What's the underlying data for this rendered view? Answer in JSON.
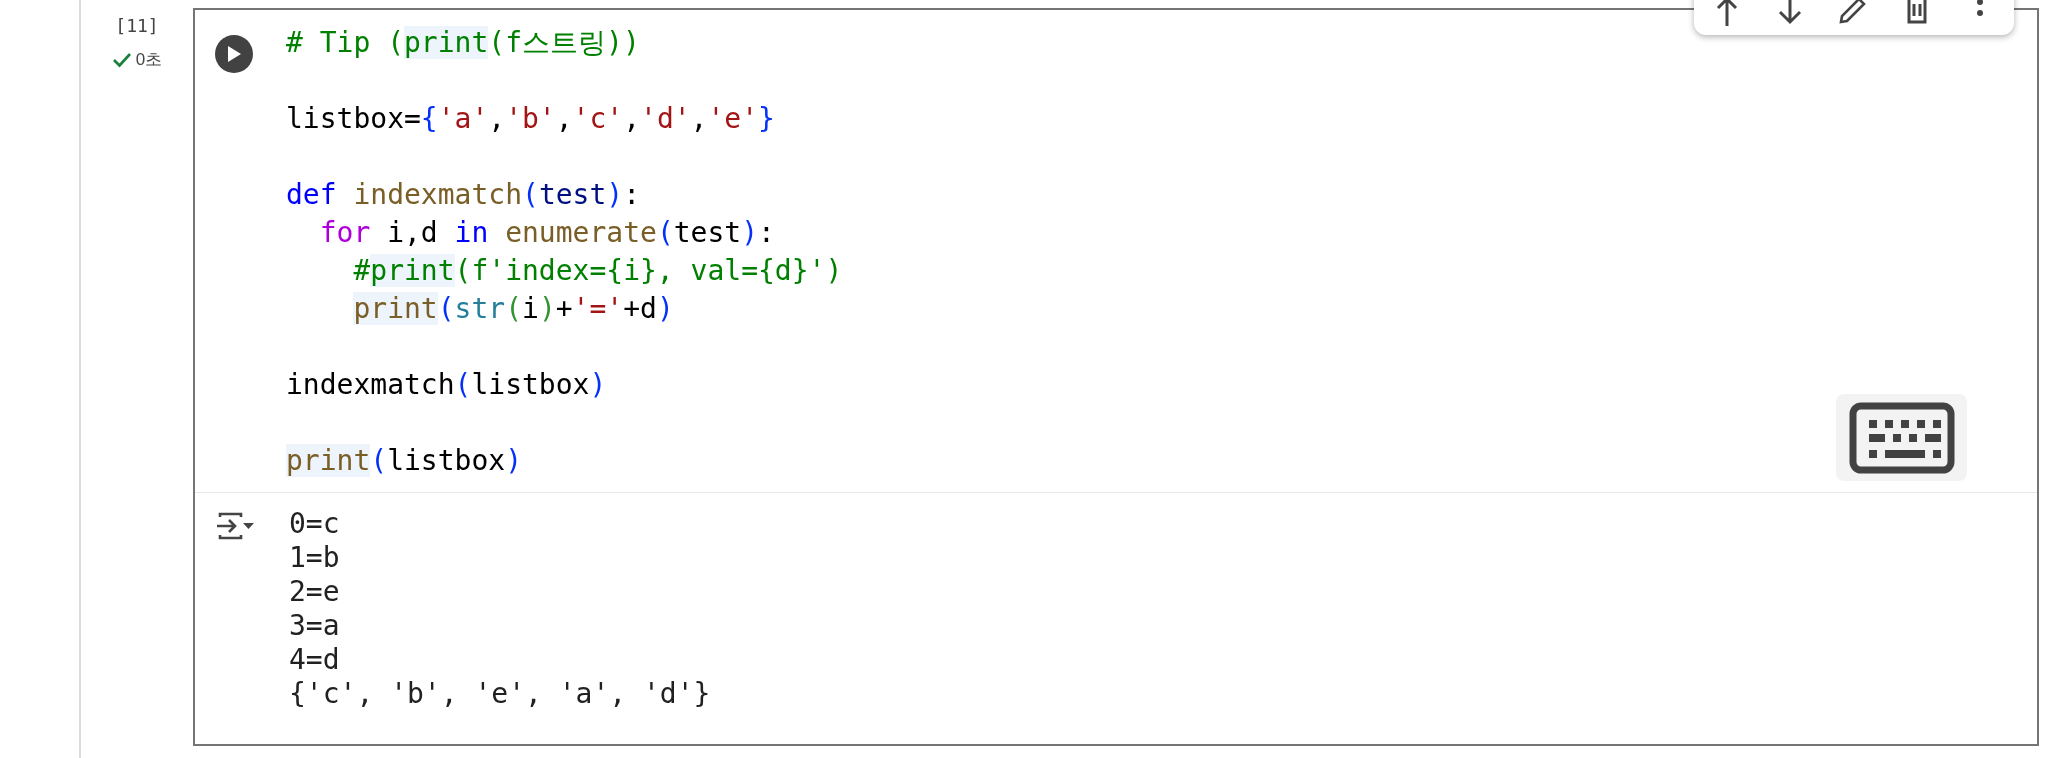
{
  "cell": {
    "execution_count": "[11]",
    "status": {
      "succeeded": true,
      "duration": "0초"
    },
    "code": {
      "blocks": [
        {
          "lines": [
            {
              "tokens": [
                {
                  "text": "# Tip (",
                  "kind": "comment",
                  "highlighted": false
                },
                {
                  "text": "print",
                  "kind": "comment",
                  "highlighted": true
                },
                {
                  "text": "(f스트링))",
                  "kind": "comment",
                  "highlighted": false
                }
              ]
            }
          ]
        },
        {
          "lines": [
            {
              "tokens": [
                {
                  "text": "listbox=",
                  "kind": "plain",
                  "highlighted": false
                },
                {
                  "text": "{",
                  "kind": "bracket",
                  "highlighted": false
                },
                {
                  "text": "'a'",
                  "kind": "string",
                  "highlighted": false
                },
                {
                  "text": ",",
                  "kind": "plain",
                  "highlighted": false
                },
                {
                  "text": "'b'",
                  "kind": "string",
                  "highlighted": false
                },
                {
                  "text": ",",
                  "kind": "plain",
                  "highlighted": false
                },
                {
                  "text": "'c'",
                  "kind": "string",
                  "highlighted": false
                },
                {
                  "text": ",",
                  "kind": "plain",
                  "highlighted": false
                },
                {
                  "text": "'d'",
                  "kind": "string",
                  "highlighted": false
                },
                {
                  "text": ",",
                  "kind": "plain",
                  "highlighted": false
                },
                {
                  "text": "'e'",
                  "kind": "string",
                  "highlighted": false
                },
                {
                  "text": "}",
                  "kind": "bracket",
                  "highlighted": false
                }
              ]
            }
          ]
        },
        {
          "lines": [
            {
              "tokens": [
                {
                  "text": "def ",
                  "kind": "keyword",
                  "highlighted": false
                },
                {
                  "text": "indexmatch",
                  "kind": "function",
                  "highlighted": false
                },
                {
                  "text": "(",
                  "kind": "bracket",
                  "highlighted": false
                },
                {
                  "text": "test",
                  "kind": "parameter",
                  "highlighted": false
                },
                {
                  "text": ")",
                  "kind": "bracket",
                  "highlighted": false
                },
                {
                  "text": ":",
                  "kind": "plain",
                  "highlighted": false
                }
              ],
              "children": [
                {
                  "tokens": [
                    {
                      "text": "for",
                      "kind": "control",
                      "highlighted": false
                    },
                    {
                      "text": " i,d ",
                      "kind": "plain",
                      "highlighted": false
                    },
                    {
                      "text": "in ",
                      "kind": "keyword",
                      "highlighted": false
                    },
                    {
                      "text": "enumerate",
                      "kind": "function",
                      "highlighted": false
                    },
                    {
                      "text": "(",
                      "kind": "bracket",
                      "highlighted": false
                    },
                    {
                      "text": "test",
                      "kind": "plain",
                      "highlighted": false
                    },
                    {
                      "text": ")",
                      "kind": "bracket",
                      "highlighted": false
                    },
                    {
                      "text": ":",
                      "kind": "plain",
                      "highlighted": false
                    }
                  ],
                  "children": [
                    {
                      "tokens": [
                        {
                          "text": "#",
                          "kind": "comment",
                          "highlighted": false
                        },
                        {
                          "text": "print",
                          "kind": "comment",
                          "highlighted": true
                        },
                        {
                          "text": "(f'index={i}, val={d}')",
                          "kind": "comment",
                          "highlighted": false
                        }
                      ]
                    },
                    {
                      "tokens": [
                        {
                          "text": "print",
                          "kind": "function",
                          "highlighted": true
                        },
                        {
                          "text": "(",
                          "kind": "bracket",
                          "highlighted": false
                        },
                        {
                          "text": "str",
                          "kind": "type",
                          "highlighted": false
                        },
                        {
                          "text": "(",
                          "kind": "bracket2",
                          "highlighted": false
                        },
                        {
                          "text": "i",
                          "kind": "plain",
                          "highlighted": false
                        },
                        {
                          "text": ")",
                          "kind": "bracket2",
                          "highlighted": false
                        },
                        {
                          "text": "+",
                          "kind": "plain",
                          "highlighted": false
                        },
                        {
                          "text": "'='",
                          "kind": "string",
                          "highlighted": false
                        },
                        {
                          "text": "+d",
                          "kind": "plain",
                          "highlighted": false
                        },
                        {
                          "text": ")",
                          "kind": "bracket",
                          "highlighted": false
                        }
                      ]
                    }
                  ]
                }
              ]
            }
          ]
        },
        {
          "lines": [
            {
              "tokens": [
                {
                  "text": "indexmatch",
                  "kind": "plain",
                  "highlighted": false
                },
                {
                  "text": "(",
                  "kind": "bracket",
                  "highlighted": false
                },
                {
                  "text": "listbox",
                  "kind": "plain",
                  "highlighted": false
                },
                {
                  "text": ")",
                  "kind": "bracket",
                  "highlighted": false
                }
              ]
            }
          ]
        },
        {
          "lines": [
            {
              "tokens": [
                {
                  "text": "print",
                  "kind": "function",
                  "highlighted": true
                },
                {
                  "text": "(",
                  "kind": "bracket",
                  "highlighted": false
                },
                {
                  "text": "listbox",
                  "kind": "plain",
                  "highlighted": false
                },
                {
                  "text": ")",
                  "kind": "bracket",
                  "highlighted": false
                }
              ]
            }
          ]
        }
      ]
    },
    "output": {
      "lines": [
        "0=c",
        "1=b",
        "2=e",
        "3=a",
        "4=d",
        "{'c', 'b', 'e', 'a', 'd'}"
      ]
    }
  }
}
